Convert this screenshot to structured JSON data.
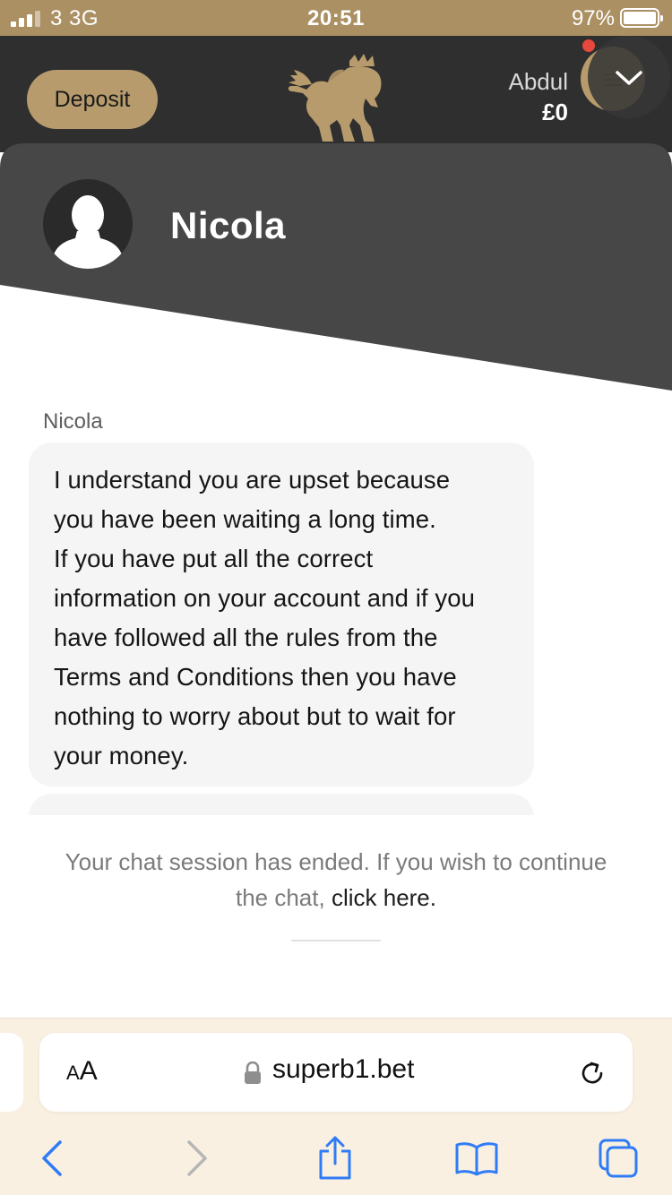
{
  "status_bar": {
    "carrier": "3  3G",
    "time": "20:51",
    "battery_percent": "97%"
  },
  "header": {
    "deposit_label": "Deposit",
    "user_name": "Abdul",
    "balance": "£0",
    "brand_color": "#b79b6c",
    "logo_icon": "winged-lion-logo"
  },
  "chat": {
    "agent_name": "Nicola",
    "messages": [
      {
        "sender": "Nicola",
        "lines": [
          "I understand you are upset because",
          "you have been waiting a long time.",
          "If you have put all the correct",
          "information on your account and if you",
          "have followed all the rules from the",
          "Terms and Conditions then you have",
          "nothing to worry about but to wait for",
          "your money."
        ]
      }
    ],
    "session_ended_text": "Your chat session has ended. If you wish to continue the chat,",
    "session_ended_link": "click here."
  },
  "browser": {
    "text_size_label": "AA",
    "url": "superb1.bet"
  }
}
